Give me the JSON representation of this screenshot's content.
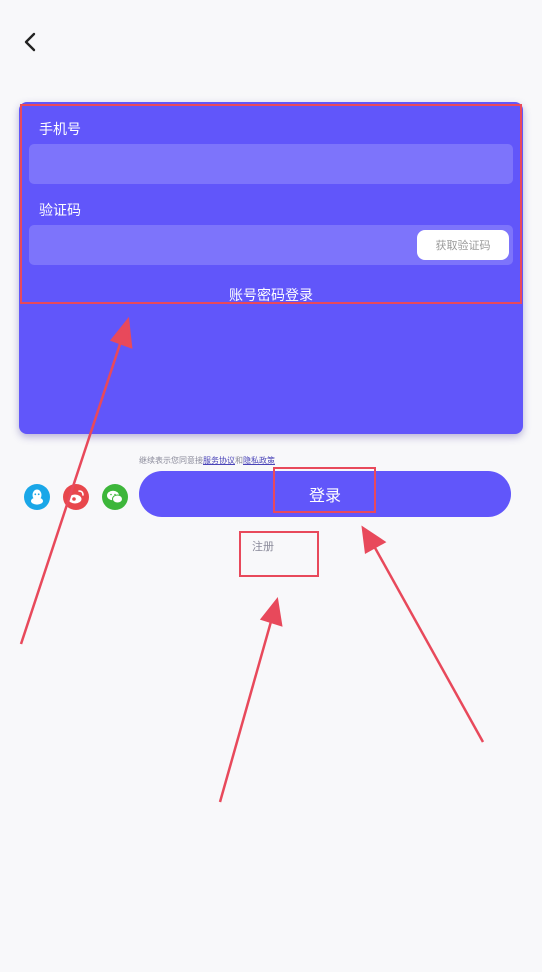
{
  "nav": {
    "back_icon": "chevron-left-icon"
  },
  "form": {
    "phone_label": "手机号",
    "phone_value": "",
    "phone_placeholder": "",
    "code_label": "验证码",
    "code_value": "",
    "code_placeholder": "",
    "get_code_label": "获取验证码",
    "password_login_link": "账号密码登录"
  },
  "agreement": {
    "prefix": "继续表示您同意接",
    "terms_link": "服务协议",
    "and": "和",
    "privacy_link": "隐私政策"
  },
  "social": [
    {
      "icon": "qq-icon",
      "color": "#1aa7e8"
    },
    {
      "icon": "weibo-icon",
      "color": "#e8474c"
    },
    {
      "icon": "wechat-icon",
      "color": "#3db63a"
    }
  ],
  "actions": {
    "login_label": "登录",
    "register_label": "注册"
  },
  "colors": {
    "accent": "#6156fa",
    "annotation": "#e8495b"
  }
}
